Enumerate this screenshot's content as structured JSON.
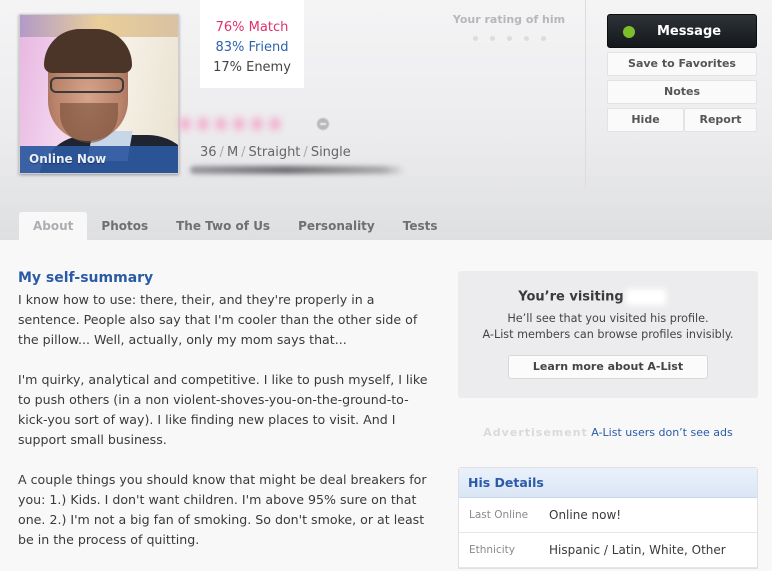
{
  "profile": {
    "online_badge": "Online Now",
    "match": "76% Match",
    "friend": "83% Friend",
    "enemy": "17% Enemy",
    "basics": {
      "age": "36",
      "gender": "M",
      "orientation": "Straight",
      "status": "Single",
      "separator": "/"
    }
  },
  "rating": {
    "label": "Your rating of him",
    "max_stars": 5,
    "value": 0
  },
  "actions": {
    "message": "Message",
    "favorites": "Save to Favorites",
    "notes": "Notes",
    "hide": "Hide",
    "report": "Report"
  },
  "colors": {
    "match": "#e0306e",
    "friend": "#2d63ad",
    "online_dot": "#7ebd2c",
    "accent": "#2b5ba6"
  },
  "tabs": [
    {
      "label": "About",
      "active": true
    },
    {
      "label": "Photos",
      "active": false
    },
    {
      "label": "The Two of Us",
      "active": false
    },
    {
      "label": "Personality",
      "active": false
    },
    {
      "label": "Tests",
      "active": false
    }
  ],
  "essay": {
    "title": "My self-summary",
    "paragraphs": [
      "I know how to use: there, their, and they're properly in a sentence. People also say that I'm cooler than the other side of the pillow... Well, actually, only my mom says that...",
      "I'm quirky, analytical and competitive. I like to push myself, I like to push others (in a non violent-shoves-you-on-the-ground-to-kick-you sort of way). I like finding new places to visit. And I support small business.",
      "A couple things you should know that might be deal breakers for you: 1.) Kids. I don't want children. I'm above 95% sure on that one. 2.) I'm not a big fan of smoking. So don't smoke, or at least be in the process of quitting."
    ]
  },
  "visit_box": {
    "title": "You’re visiting",
    "line1": "He’ll see that you visited his profile.",
    "line2": "A-List members can browse profiles invisibly.",
    "button": "Learn more about A-List"
  },
  "ad": {
    "label": "Advertisement",
    "link": "A-List users don’t see ads"
  },
  "details": {
    "title": "His Details",
    "rows": [
      {
        "key": "Last Online",
        "value": "Online now!"
      },
      {
        "key": "Ethnicity",
        "value": "Hispanic / Latin, White, Other"
      }
    ]
  }
}
